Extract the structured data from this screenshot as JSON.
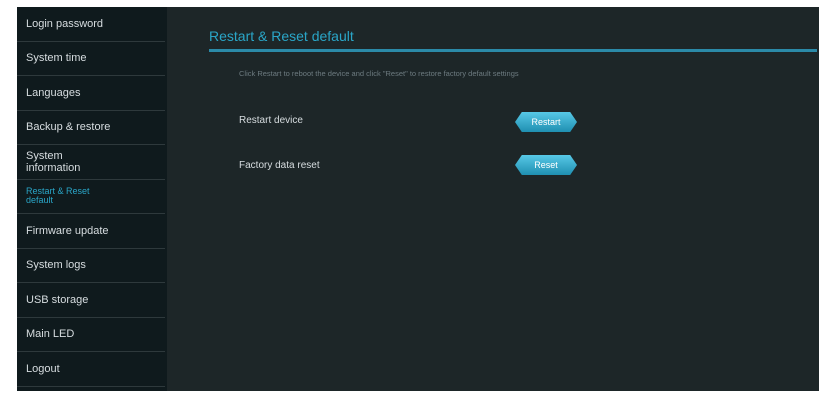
{
  "sidebar": {
    "items": [
      {
        "label": "Login password",
        "active": false
      },
      {
        "label": "System time",
        "active": false
      },
      {
        "label": "Languages",
        "active": false
      },
      {
        "label": "Backup & restore",
        "active": false
      },
      {
        "label": "System information",
        "active": false
      },
      {
        "label": "Restart & Reset default",
        "active": true
      },
      {
        "label": "Firmware update",
        "active": false
      },
      {
        "label": "System logs",
        "active": false
      },
      {
        "label": "USB storage",
        "active": false
      },
      {
        "label": "Main LED",
        "active": false
      },
      {
        "label": "Logout",
        "active": false
      }
    ]
  },
  "main": {
    "title": "Restart & Reset default",
    "description": "Click Restart to reboot the device and click \"Reset\" to restore factory default settings",
    "restart": {
      "label": "Restart device",
      "button_label": "Restart"
    },
    "reset": {
      "label": "Factory data reset",
      "button_label": "Reset"
    }
  },
  "colors": {
    "accent": "#2aa6c8",
    "background": "#1d2628",
    "sidebar_background": "#0f1a1d"
  }
}
